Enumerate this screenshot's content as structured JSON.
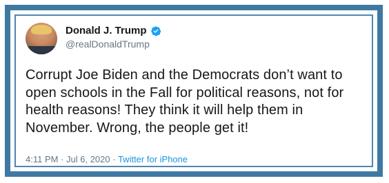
{
  "tweet": {
    "display_name": "Donald J. Trump",
    "handle": "@realDonaldTrump",
    "verified": true,
    "text": "Corrupt Joe Biden and the Democrats don’t want to\nopen schools in the Fall for political reasons, not for\nhealth reasons! They think it will help them in\nNovember. Wrong, the people get it!",
    "time": "4:11 PM",
    "separator1": " · ",
    "date": "Jul 6, 2020",
    "separator2": " · ",
    "source": "Twitter for iPhone"
  },
  "icons": {
    "verified": "verified-badge-icon",
    "avatar": "profile-avatar"
  },
  "colors": {
    "frame_border": "#3f79a3",
    "verified_badge": "#1da1f2",
    "link": "#1b95e0",
    "secondary_text": "#657786",
    "primary_text": "#14171a"
  }
}
